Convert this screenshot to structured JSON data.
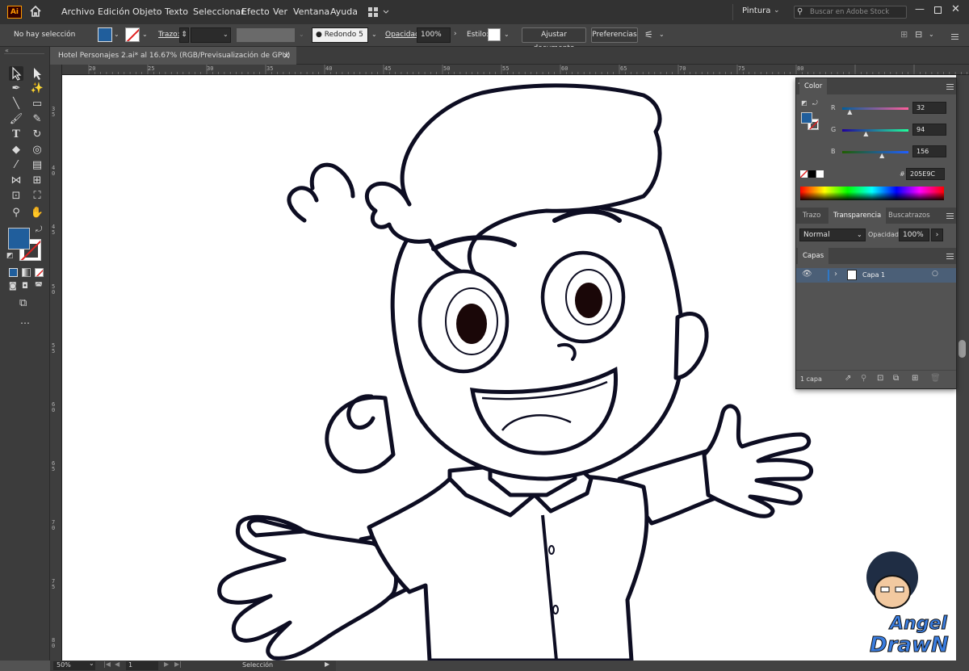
{
  "app": {
    "logo": "Ai"
  },
  "menu": [
    "Archivo",
    "Edición",
    "Objeto",
    "Texto",
    "Seleccionar",
    "Efecto",
    "Ver",
    "Ventana",
    "Ayuda"
  ],
  "workspace": "Pintura",
  "search_placeholder": "Buscar en Adobe Stock",
  "control": {
    "selection": "No hay selección",
    "stroke_label": "Trazo:",
    "brush": "Redondo 5 ...",
    "opacity_label": "Opacidad:",
    "opacity_value": "100%",
    "style_label": "Estilo:",
    "doc_setup": "Ajustar documento",
    "prefs": "Preferencias"
  },
  "document_tab": {
    "title": "Hotel Personajes 2.ai* al 16.67% (RGB/Previsualización de GPU)",
    "close": "×"
  },
  "ruler_top": [
    "20",
    "25",
    "30",
    "35",
    "40",
    "45",
    "50",
    "55",
    "60",
    "65",
    "70",
    "75",
    "80"
  ],
  "ruler_left": [
    "3 5",
    "4 0",
    "4 5",
    "5 0",
    "5 5",
    "6 0",
    "6 5",
    "7 0",
    "7 5",
    "8 0"
  ],
  "colors": {
    "fill": "#205E9C",
    "accent": "#2d78c8"
  },
  "color_panel": {
    "title": "Color",
    "r": {
      "label": "R",
      "value": "32",
      "fraction": 0.125
    },
    "g": {
      "label": "G",
      "value": "94",
      "fraction": 0.369
    },
    "b": {
      "label": "B",
      "value": "156",
      "fraction": 0.612
    },
    "hex_label": "#",
    "hex": "205E9C"
  },
  "transparency_panel": {
    "tabs": [
      "Trazo",
      "Transparencia",
      "Buscatrazos"
    ],
    "blend_mode": "Normal",
    "opacity_label": "Opacidad:",
    "opacity_value": "100%"
  },
  "layers_panel": {
    "title": "Capas",
    "layer_name": "Capa 1",
    "count": "1 capa"
  },
  "status": {
    "zoom": "50%",
    "page": "1",
    "tool": "Selección"
  },
  "watermark": {
    "line1": "Angel",
    "line2": "DrawN"
  }
}
